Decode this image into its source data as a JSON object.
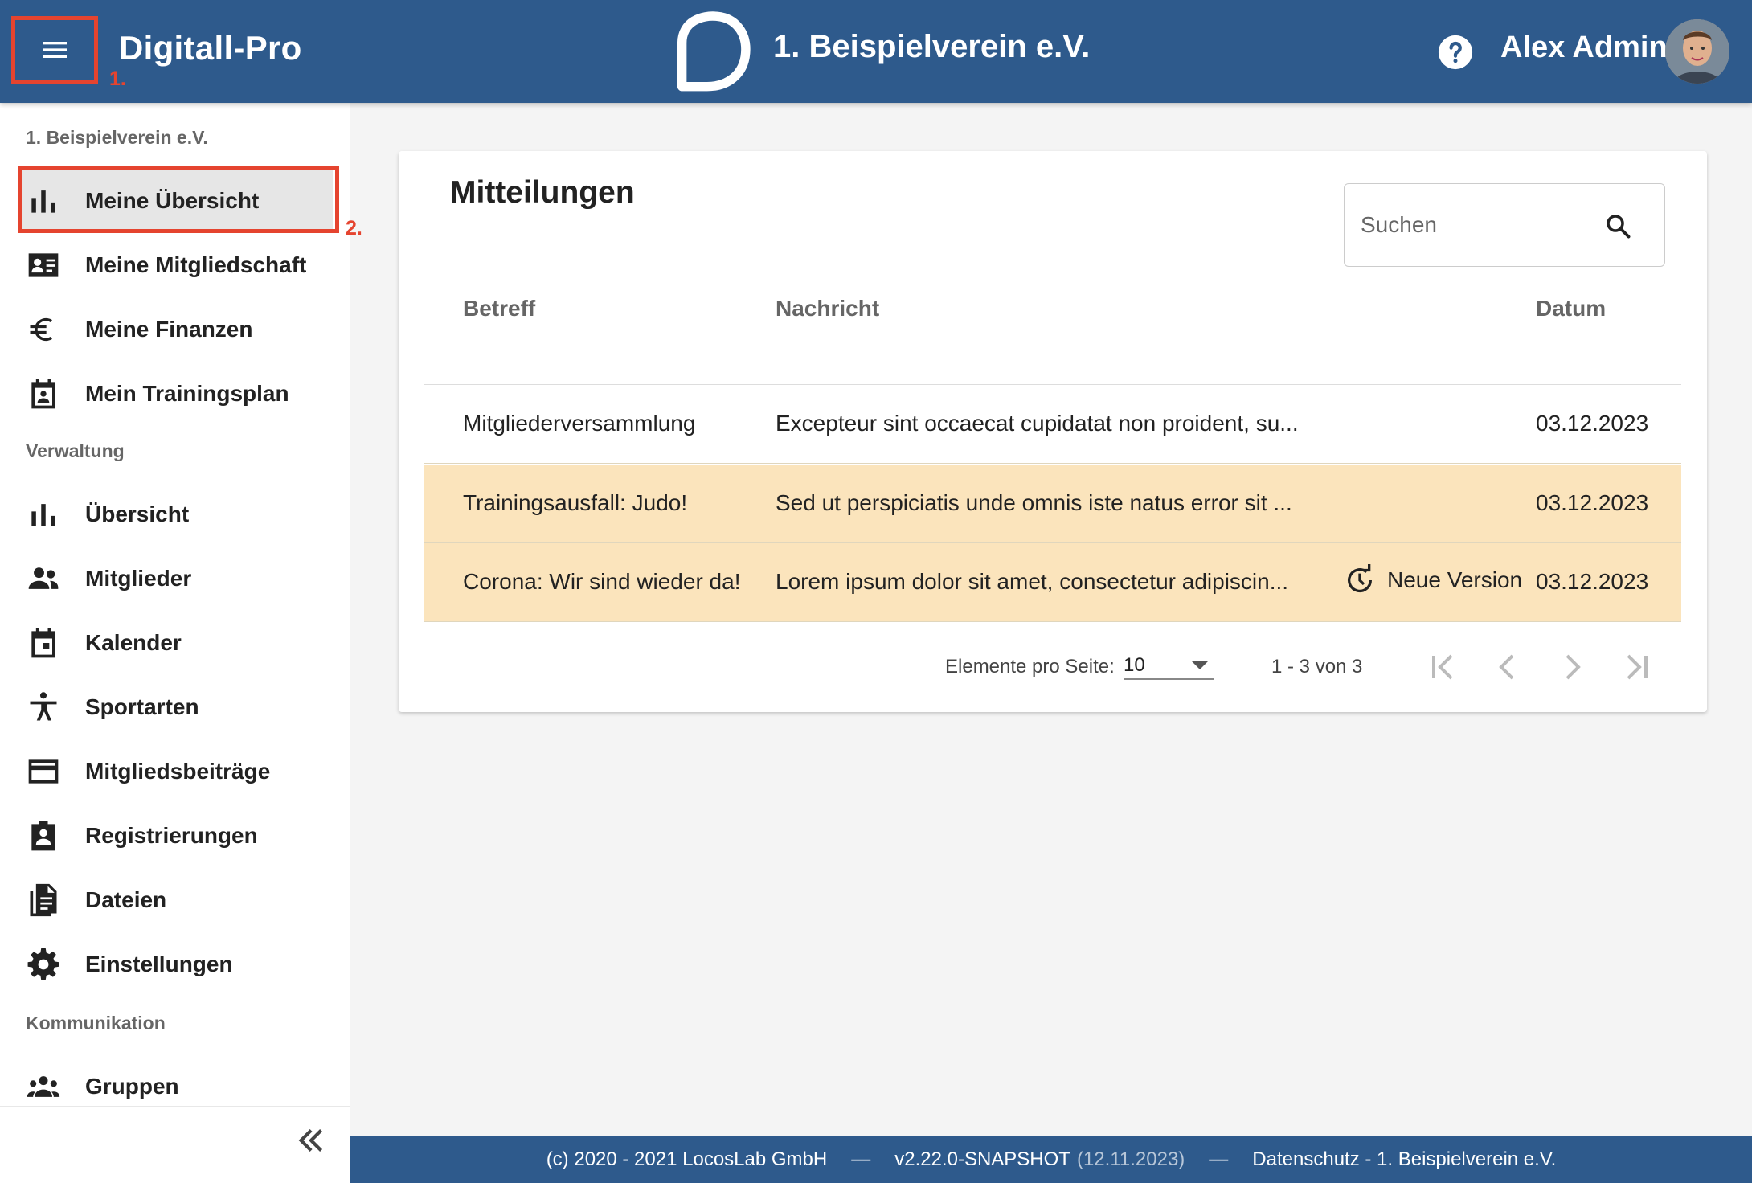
{
  "header": {
    "app_title": "Digitall-Pro",
    "club_name": "1. Beispielverein e.V.",
    "user_name": "Alex Admin",
    "annotation_1": "1.",
    "annotation_2": "2."
  },
  "sidebar": {
    "club_section": "1. Beispielverein e.V.",
    "my_items": [
      {
        "label": "Meine Übersicht",
        "icon": "bar-chart-icon"
      },
      {
        "label": "Meine Mitgliedschaft",
        "icon": "id-card-icon"
      },
      {
        "label": "Meine Finanzen",
        "icon": "euro-icon"
      },
      {
        "label": "Mein Trainingsplan",
        "icon": "calendar-person-icon"
      }
    ],
    "admin_section": "Verwaltung",
    "admin_items": [
      {
        "label": "Übersicht",
        "icon": "bar-chart-icon"
      },
      {
        "label": "Mitglieder",
        "icon": "people-icon"
      },
      {
        "label": "Kalender",
        "icon": "calendar-icon"
      },
      {
        "label": "Sportarten",
        "icon": "sport-icon"
      },
      {
        "label": "Mitgliedsbeiträge",
        "icon": "credit-card-icon"
      },
      {
        "label": "Registrierungen",
        "icon": "clipboard-person-icon"
      },
      {
        "label": "Dateien",
        "icon": "files-icon"
      },
      {
        "label": "Einstellungen",
        "icon": "gear-icon"
      }
    ],
    "comm_section": "Kommunikation",
    "comm_items": [
      {
        "label": "Gruppen",
        "icon": "groups-icon"
      }
    ]
  },
  "messages": {
    "title": "Mitteilungen",
    "search_placeholder": "Suchen",
    "columns": {
      "subject": "Betreff",
      "message": "Nachricht",
      "date": "Datum"
    },
    "rows": [
      {
        "subject": "Mitgliederversammlung",
        "message": "Excepteur sint occaecat cupidatat non proident, su...",
        "date": "03.12.2023",
        "badge": ""
      },
      {
        "subject": "Trainingsausfall: Judo!",
        "message": "Sed ut perspiciatis unde omnis iste natus error sit ...",
        "date": "03.12.2023",
        "badge": ""
      },
      {
        "subject": "Corona: Wir sind wieder da!",
        "message": "Lorem ipsum dolor sit amet, consectetur adipiscin...",
        "date": "03.12.2023",
        "badge": "Neue Version"
      }
    ],
    "paginator": {
      "items_per_page_label": "Elemente pro Seite:",
      "items_per_page": "10",
      "range": "1 - 3 von 3"
    }
  },
  "footer": {
    "copyright": "(c) 2020 - 2021 LocosLab GmbH",
    "separator": "—",
    "version": "v2.22.0-SNAPSHOT",
    "build_date": "(12.11.2023)",
    "privacy": "Datenschutz - 1. Beispielverein e.V."
  },
  "colors": {
    "primary": "#2e5a8c",
    "highlight_row": "#fbe4bc",
    "annotation": "#e5442f"
  }
}
